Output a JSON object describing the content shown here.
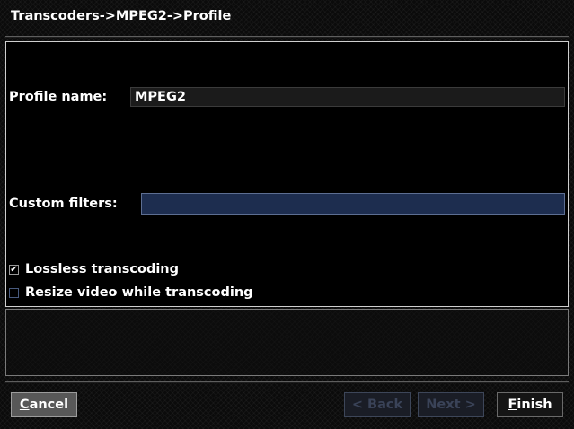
{
  "window": {
    "title": "Transcoders->MPEG2->Profile"
  },
  "form": {
    "profile_name_label": "Profile name:",
    "profile_name_value": "MPEG2",
    "custom_filters_label": "Custom filters:",
    "custom_filters_value": "",
    "lossless_label": "Lossless transcoding",
    "lossless_checked": true,
    "lossless_mark": "✔",
    "resize_label": "Resize video while transcoding",
    "resize_checked": false
  },
  "help": {
    "text": ""
  },
  "buttons": {
    "cancel_mnemonic": "C",
    "cancel_rest": "ancel",
    "back_label": "< Back",
    "next_label": "Next >",
    "finish_mnemonic": "F",
    "finish_rest": "inish"
  },
  "colors": {
    "background": "#0b0b0b",
    "panel_border": "#cfcfcf",
    "focused_field": "#1d2d4f",
    "disabled_text": "#3a4358"
  }
}
